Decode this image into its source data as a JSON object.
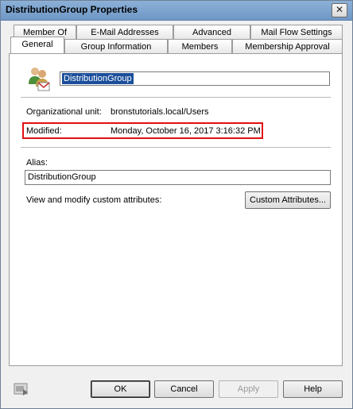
{
  "window": {
    "title": "DistributionGroup Properties"
  },
  "tabs": {
    "top_row": [
      "Member Of",
      "E-Mail Addresses",
      "Advanced",
      "Mail Flow Settings"
    ],
    "bottom_row": [
      "General",
      "Group Information",
      "Members",
      "Membership Approval"
    ],
    "active": "General"
  },
  "general": {
    "name_value": "DistributionGroup",
    "org_unit_label": "Organizational unit:",
    "org_unit_value": "bronstutorials.local/Users",
    "modified_label": "Modified:",
    "modified_value": "Monday, October 16, 2017 3:16:32 PM",
    "alias_label": "Alias:",
    "alias_value": "DistributionGroup",
    "custom_attr_text": "View and modify custom attributes:",
    "custom_attr_button": "Custom Attributes..."
  },
  "buttons": {
    "ok": "OK",
    "cancel": "Cancel",
    "apply": "Apply",
    "help": "Help"
  },
  "colors": {
    "highlight_border": "#e01010",
    "selection": "#1b4f9b"
  }
}
